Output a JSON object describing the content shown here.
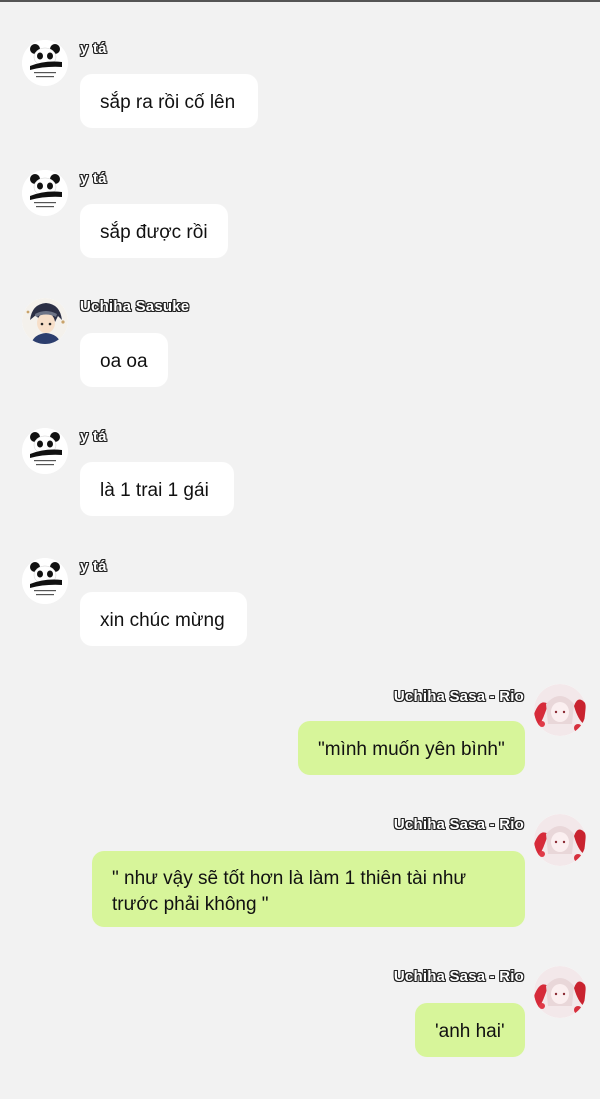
{
  "messages": [
    {
      "side": "left",
      "avatar": "panda-meme-avatar",
      "sender": "y tá",
      "text": "sắp ra rồi cố lên"
    },
    {
      "side": "left",
      "avatar": "panda-meme-avatar",
      "sender": "y tá",
      "text": "sắp được rồi"
    },
    {
      "side": "left",
      "avatar": "sasuke-avatar",
      "sender": "Uchiha Sasuke",
      "text": "oa oa"
    },
    {
      "side": "left",
      "avatar": "panda-meme-avatar",
      "sender": "y tá",
      "text": "là 1 trai 1 gái"
    },
    {
      "side": "left",
      "avatar": "panda-meme-avatar",
      "sender": "y tá",
      "text": "xin chúc mừng"
    },
    {
      "side": "right",
      "avatar": "sasa-avatar",
      "sender": "Uchiha Sasa - Rio",
      "text": "\"mình muốn yên bình\""
    },
    {
      "side": "right",
      "avatar": "sasa-avatar",
      "sender": "Uchiha Sasa - Rio",
      "text": "\" như vậy sẽ tốt hơn là làm 1 thiên tài như trước phải không \""
    },
    {
      "side": "right",
      "avatar": "sasa-avatar",
      "sender": "Uchiha Sasa - Rio",
      "text": "'anh hai'"
    }
  ],
  "colors": {
    "background": "#f2f2f2",
    "left_bubble": "#ffffff",
    "right_bubble": "#d7f59a"
  }
}
